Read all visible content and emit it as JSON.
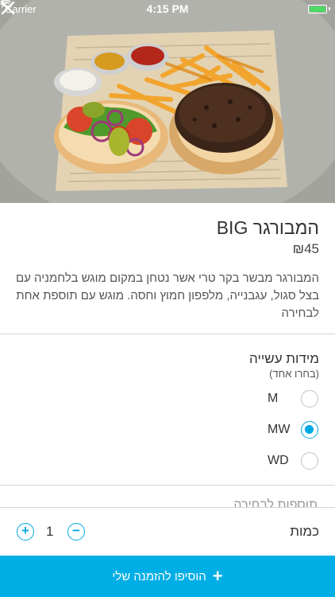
{
  "status_bar": {
    "carrier": "Carrier",
    "time": "4:15 PM"
  },
  "item": {
    "title": "המבורגר BIG",
    "price": "₪45",
    "description": "המבורגר מבשר בקר טרי אשר נטחן במקום מוגש בלחמניה עם בצל סגול, עגבנייה, מלפפון חמוץ וחסה. מוגש עם תוספת אחת לבחירה"
  },
  "doneness": {
    "title": "מידות עשייה",
    "subtitle": "(בחרו אחד)",
    "options": [
      {
        "label": "M",
        "selected": false
      },
      {
        "label": "MW",
        "selected": true
      },
      {
        "label": "WD",
        "selected": false
      }
    ]
  },
  "next_group_title": "תוספות לבחירה",
  "quantity": {
    "label": "כמות",
    "value": "1",
    "plus": "+",
    "minus": "−"
  },
  "add_button": {
    "label": "הוסיפו להזמנה שלי",
    "icon": "plus-icon"
  },
  "colors": {
    "accent": "#00aee6",
    "battery": "#4cd964"
  },
  "image": {
    "subject": "burger-with-fries-photo"
  }
}
